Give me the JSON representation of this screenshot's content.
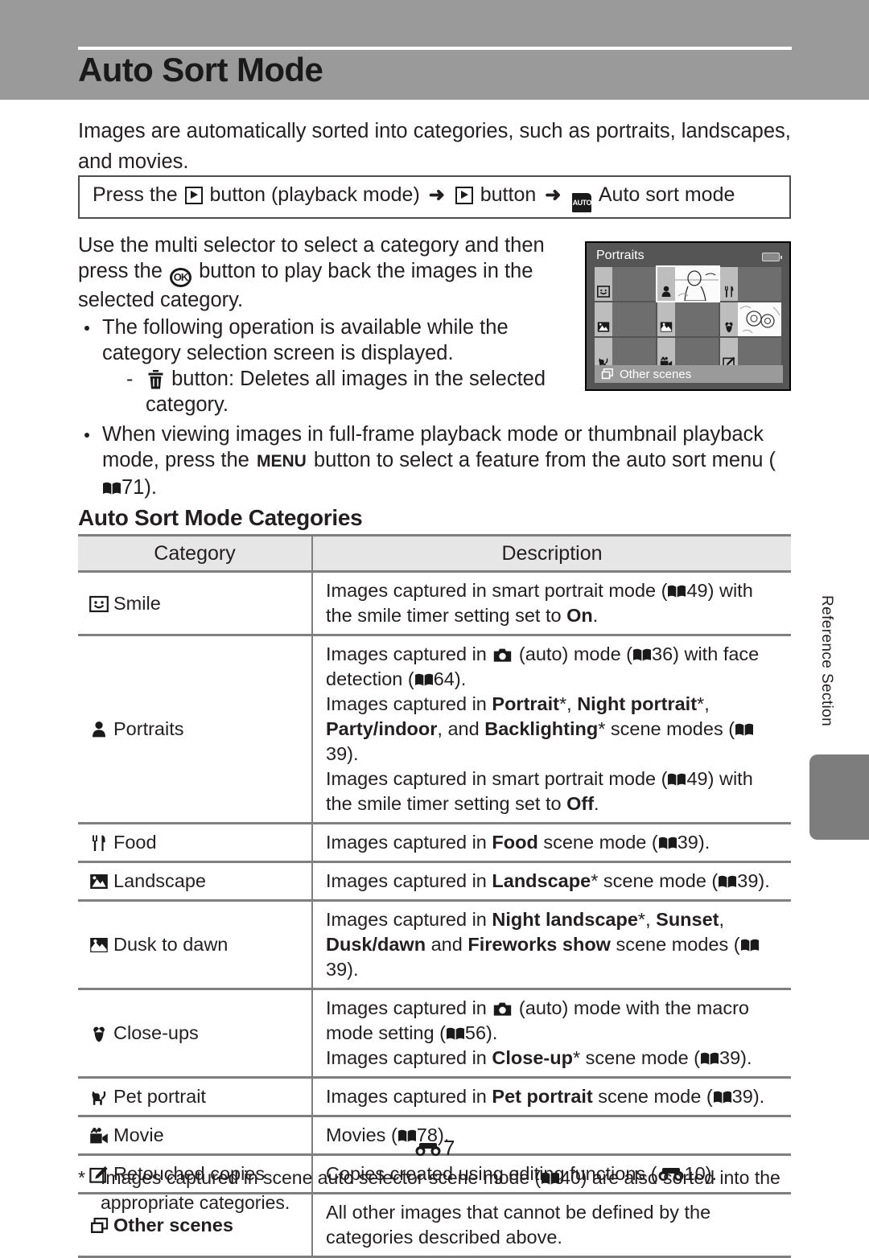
{
  "header": {
    "title": "Auto Sort Mode"
  },
  "intro": {
    "text": "Images are automatically sorted into categories, such as portraits, landscapes, and movies."
  },
  "press_box": {
    "part1": "Press the",
    "part2": "button (playback mode)",
    "part3": "button",
    "part4": "Auto sort mode",
    "play_icon": "playback-button-icon",
    "auto_icon": "auto-sort-mode-icon",
    "auto_badge_text": "AUTO",
    "arrow": "➜"
  },
  "instructions": {
    "para_1a": "Use the multi selector to select a category and then press the",
    "para_1b": "button to play back the images in the selected category.",
    "ok_label": "OK",
    "bullet_1": "The following operation is available while the category selection screen is displayed.",
    "sub_1a": "button: Deletes all images in the selected category.",
    "trash_icon": "trash-can-icon",
    "bullet_2a": "When viewing images in full-frame playback mode or thumbnail playback mode, press the",
    "menu_label": "MENU",
    "bullet_2b": "button to select a feature from the auto sort menu (",
    "bullet_2_ref": "71",
    "bullet_2c": ").",
    "book_icon": "manual-page-reference-icon"
  },
  "camera_screen": {
    "title": "Portraits",
    "battery_icon": "battery-level-icon",
    "bottom_label": "Other scenes",
    "bottom_icon": "other-scenes-icon",
    "cells": [
      {
        "icon": "smile-icon",
        "selected": false,
        "thumb": false
      },
      {
        "icon": "portraits-icon",
        "selected": true,
        "thumb": true
      },
      {
        "icon": "food-icon",
        "selected": false,
        "thumb": false
      },
      {
        "icon": "landscape-icon",
        "selected": false,
        "thumb": false
      },
      {
        "icon": "dusk-to-dawn-icon",
        "selected": false,
        "thumb": false
      },
      {
        "icon": "close-ups-icon",
        "selected": false,
        "thumb": true
      },
      {
        "icon": "pet-portrait-icon",
        "selected": false,
        "thumb": false
      },
      {
        "icon": "movie-icon",
        "selected": false,
        "thumb": false
      },
      {
        "icon": "retouched-copies-icon",
        "selected": false,
        "thumb": false
      }
    ]
  },
  "section": {
    "subtitle": "Auto Sort Mode Categories"
  },
  "table": {
    "headers": {
      "category": "Category",
      "description": "Description"
    },
    "rows": [
      {
        "icon": "smile-icon",
        "category": "Smile",
        "lines": [
          {
            "pre": "Images captured in smart portrait mode (",
            "ref": "49",
            "mid": ") with the smile timer setting set to ",
            "bold": "On",
            "post": "."
          }
        ]
      },
      {
        "icon": "portraits-icon",
        "category": "Portraits",
        "lines": [
          {
            "pre": "Images captured in ",
            "camera": true,
            "afterCam": " (auto) mode (",
            "ref": "36",
            "mid": ") with face detection (",
            "ref2": "64",
            "post": ")."
          },
          {
            "pre": "Images captured in ",
            "boldparts": [
              "Portrait",
              "Night portrait",
              "Party/indoor",
              "Backlighting"
            ],
            "tail": " scene modes (",
            "ref": "39",
            "post": ")."
          },
          {
            "pre": "Images captured in smart portrait mode (",
            "ref": "49",
            "mid": ") with the smile timer setting set to ",
            "bold": "Off",
            "post": "."
          }
        ]
      },
      {
        "icon": "food-icon",
        "category": "Food",
        "lines": [
          {
            "pre": "Images captured in ",
            "bold": "Food",
            "mid": " scene mode (",
            "ref": "39",
            "post": ")."
          }
        ]
      },
      {
        "icon": "landscape-icon",
        "category": "Landscape",
        "lines": [
          {
            "pre": "Images captured in ",
            "bold": "Landscape",
            "star": "*",
            "mid": " scene mode (",
            "ref": "39",
            "post": ")."
          }
        ]
      },
      {
        "icon": "dusk-to-dawn-icon",
        "category": "Dusk to dawn",
        "lines": [
          {
            "pre": "Images captured in ",
            "boldparts": [
              "Night landscape",
              "Sunset",
              "Dusk/dawn",
              "Fireworks show"
            ],
            "tail": " scene modes (",
            "ref": "39",
            "post": ")."
          }
        ]
      },
      {
        "icon": "close-ups-icon",
        "category": "Close-ups",
        "lines": [
          {
            "pre": "Images captured in ",
            "camera": true,
            "afterCam": " (auto) mode with the macro mode setting (",
            "ref": "56",
            "post": ")."
          },
          {
            "pre": "Images captured in ",
            "bold": "Close-up",
            "star": "*",
            "mid": " scene mode (",
            "ref": "39",
            "post": ")."
          }
        ]
      },
      {
        "icon": "pet-portrait-icon",
        "category": "Pet portrait",
        "lines": [
          {
            "pre": "Images captured in ",
            "bold": "Pet portrait",
            "mid": " scene mode (",
            "ref": "39",
            "post": ")."
          }
        ]
      },
      {
        "icon": "movie-icon",
        "category": "Movie",
        "lines": [
          {
            "pre": "Movies (",
            "ref": "78",
            "post": ")."
          }
        ]
      },
      {
        "icon": "retouched-copies-icon",
        "category": "Retouched copies",
        "lines": [
          {
            "pre": "Copies created using editing functions (",
            "binocref": "10",
            "post": ")."
          }
        ]
      },
      {
        "icon": "other-scenes-icon",
        "category": "Other scenes",
        "bold_category": true,
        "lines": [
          {
            "pre": "All other images that cannot be defined by the categories described above."
          }
        ]
      }
    ]
  },
  "footnote": {
    "star": "*",
    "pre": "Images captured in scene auto selector scene mode (",
    "ref": "40",
    "post": ") are also sorted into the appropriate categories."
  },
  "side": {
    "label": "Reference Section",
    "tab": "reference-section-tab"
  },
  "footer": {
    "page_number": "7",
    "page_icon": "reference-section-icon"
  }
}
